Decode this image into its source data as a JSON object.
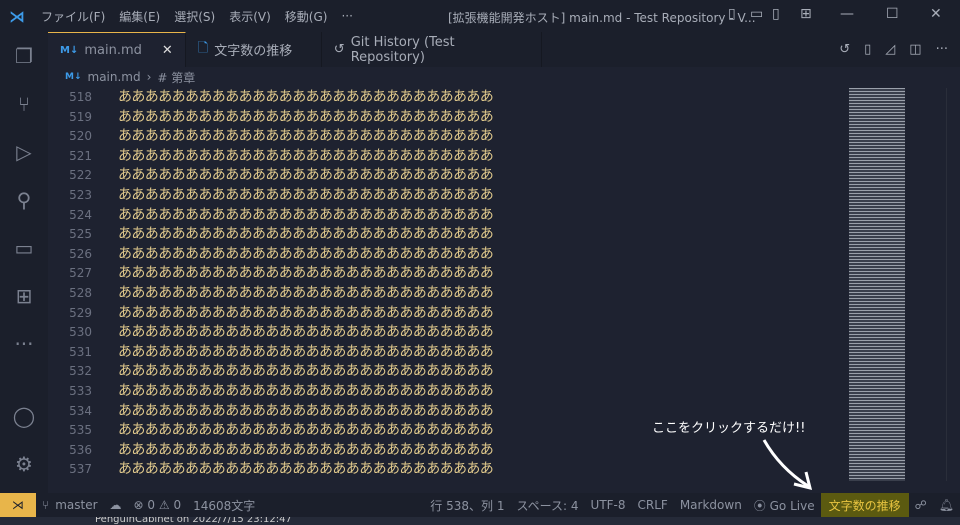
{
  "title": {
    "menus": [
      "ファイル(F)",
      "編集(E)",
      "選択(S)",
      "表示(V)",
      "移動(G)",
      "···"
    ],
    "window_title": "[拡張機能開発ホスト] main.md - Test Repository - V..."
  },
  "tabs": [
    {
      "label": "main.md",
      "badge": "M↓"
    },
    {
      "label": "文字数の推移"
    },
    {
      "label": "Git History (Test Repository)"
    }
  ],
  "breadcrumb": {
    "file": "main.md",
    "symbol": "# 第章"
  },
  "editor": {
    "line_start": 518,
    "line_end": 537,
    "text": "ああああああああああああああああああああああああああああ"
  },
  "annotation": "ここをクリックするだけ!!",
  "status": {
    "branch": "master",
    "errors": "0",
    "warnings": "0",
    "chars": "14608文字",
    "position": "行 538、列 1",
    "spaces": "スペース: 4",
    "encoding": "UTF-8",
    "eol": "CRLF",
    "language": "Markdown",
    "golive": "Go Live",
    "trend": "文字数の推移"
  },
  "bottom": "PenguinCabinet on 2022/7/15 23:12:47"
}
